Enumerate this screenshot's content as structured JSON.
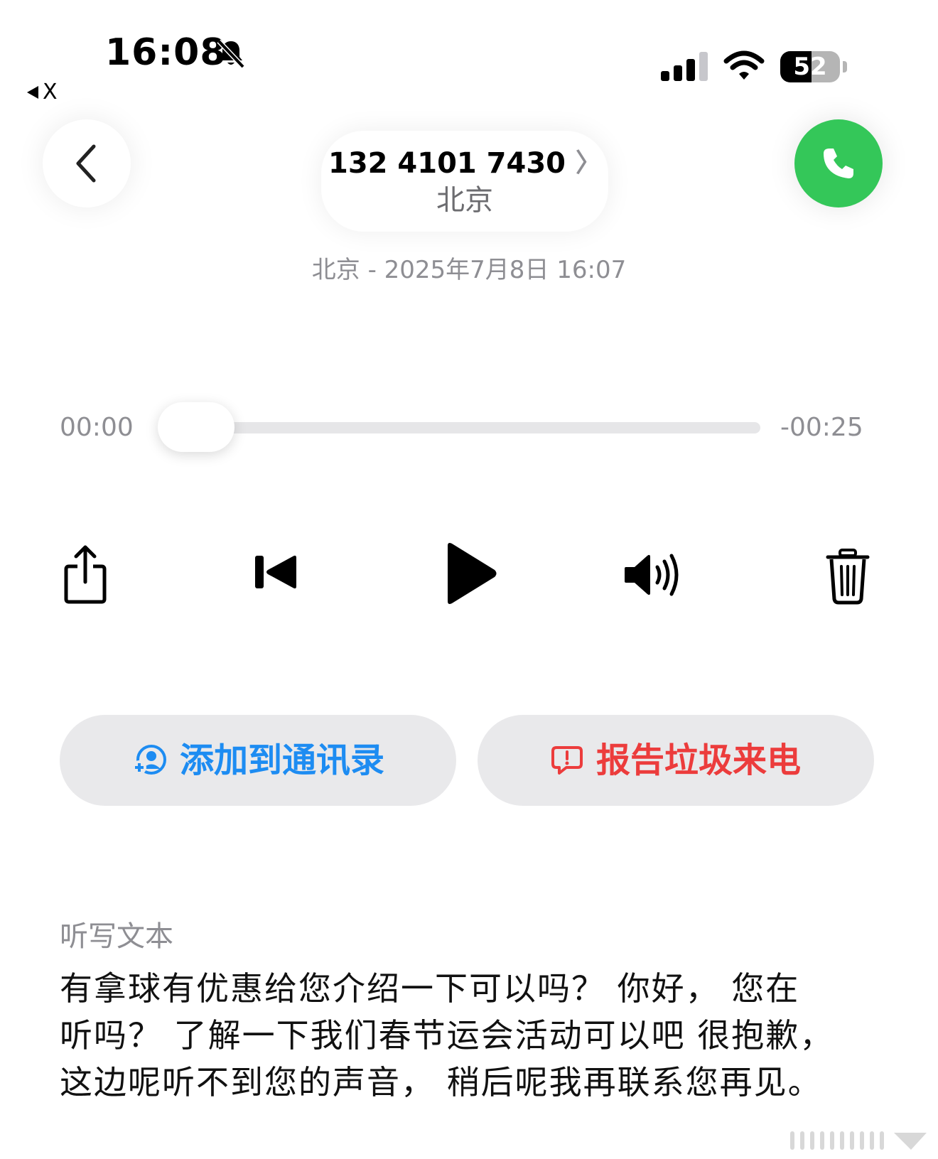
{
  "status_bar": {
    "time": "16:08",
    "back_app": "X",
    "battery": "52",
    "battery_level": 0.52,
    "icons": [
      "bell-slash-icon",
      "signal-icon",
      "wifi-icon",
      "battery-icon"
    ]
  },
  "header": {
    "phone_number": "132 4101 7430",
    "chevron": "〉",
    "location": "北京",
    "icons": [
      "chevron-left-icon",
      "phone-icon"
    ]
  },
  "call_info": {
    "date_line": "北京 - 2025年7月8日 16:07"
  },
  "player": {
    "elapsed": "00:00",
    "remaining": "-00:25",
    "progress": 0.0,
    "icons": [
      "share-icon",
      "skip-back-icon",
      "play-icon",
      "speaker-icon",
      "trash-icon"
    ]
  },
  "actions": {
    "add_contact": "添加到通讯录",
    "report_spam": "报告垃圾来电"
  },
  "colors": {
    "accent_blue": "#1d8cf2",
    "danger_red": "#ec3c3c",
    "call_green": "#34c759"
  },
  "transcript": {
    "label": "听写文本",
    "lines": [
      "有拿球有优惠给您介绍一下可以吗？ 你好， 您在",
      "听吗？ 了解一下我们春节运会活动可以吧 很抱歉，",
      "这边呢听不到您的声音， 稍后呢我再联系您再见。"
    ]
  }
}
